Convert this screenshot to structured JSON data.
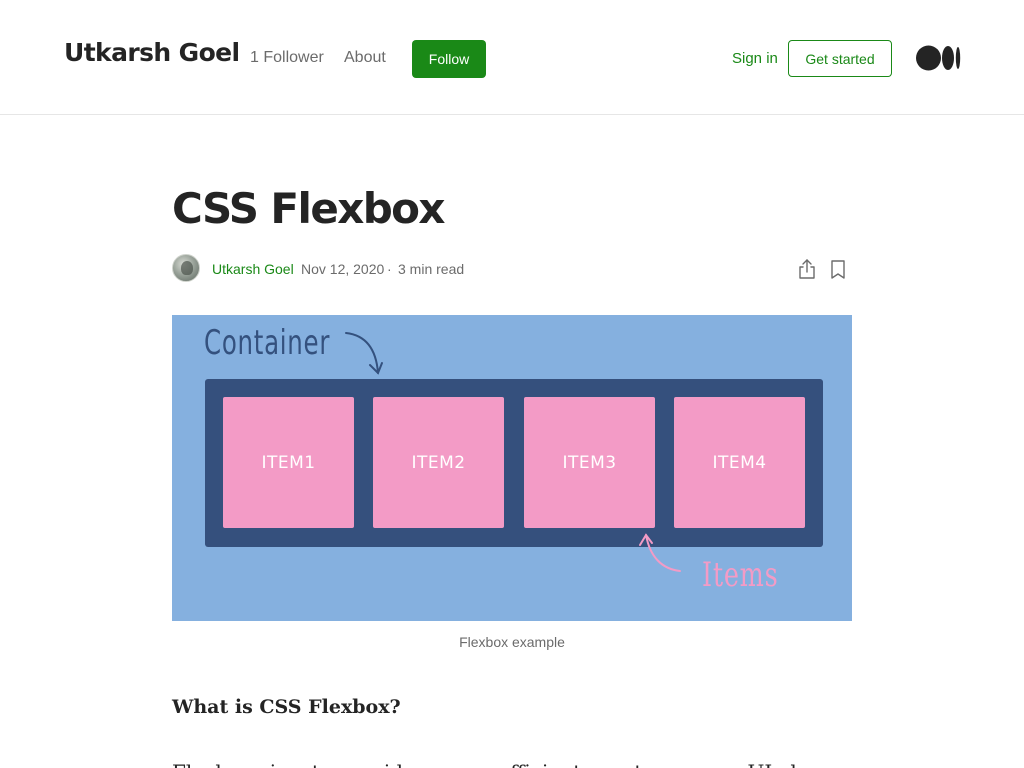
{
  "header": {
    "publication_name": "Utkarsh Goel",
    "followers": "1 Follower",
    "about": "About",
    "follow_button": "Follow",
    "sign_in": "Sign in",
    "get_started": "Get started",
    "logo_icon": "medium-logo-icon"
  },
  "article": {
    "title": "CSS Flexbox",
    "author": "Utkarsh Goel",
    "date": "Nov 12, 2020",
    "separator": "·",
    "read_time": "3 min read",
    "share_icon": "share-icon",
    "bookmark_icon": "bookmark-icon",
    "figure": {
      "container_label": "Container",
      "items": [
        "ITEM1",
        "ITEM2",
        "ITEM3",
        "ITEM4"
      ],
      "items_label": "Items",
      "caption": "Flexbox example"
    },
    "heading": "What is CSS Flexbox?",
    "paragraph_start": "Flexbox aims to provide a more efficient way to arrange UI elements. Flexbox"
  },
  "colors": {
    "accent_green": "#1a8917",
    "figure_bg": "#85b0df",
    "flex_container": "#35507d",
    "item_pink": "#f39bc6"
  }
}
